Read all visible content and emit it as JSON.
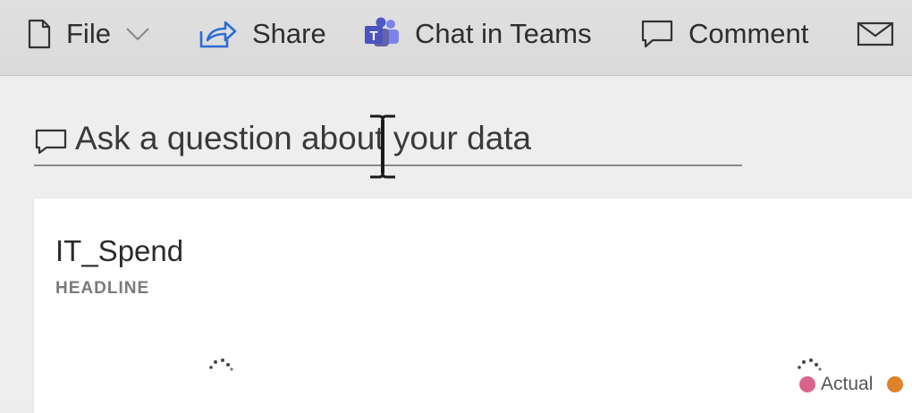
{
  "toolbar": {
    "file_label": "File",
    "share_label": "Share",
    "teams_label": "Chat in Teams",
    "comment_label": "Comment"
  },
  "qa": {
    "placeholder": "Ask a question about your data"
  },
  "card": {
    "title": "IT_Spend",
    "subtitle": "HEADLINE"
  },
  "legend": {
    "items": [
      {
        "label": "Actual",
        "color": "#d9638c"
      },
      {
        "label": "",
        "color": "#e0822b"
      }
    ]
  },
  "colors": {
    "teams_brand": "#5058c8",
    "share_icon": "#2b6cd6"
  },
  "icons": [
    "document-icon",
    "chevron-down-icon",
    "share-icon",
    "teams-icon",
    "comment-icon",
    "mail-icon",
    "chat-bubble-icon",
    "text-cursor-icon",
    "loading-spinner-icon"
  ]
}
